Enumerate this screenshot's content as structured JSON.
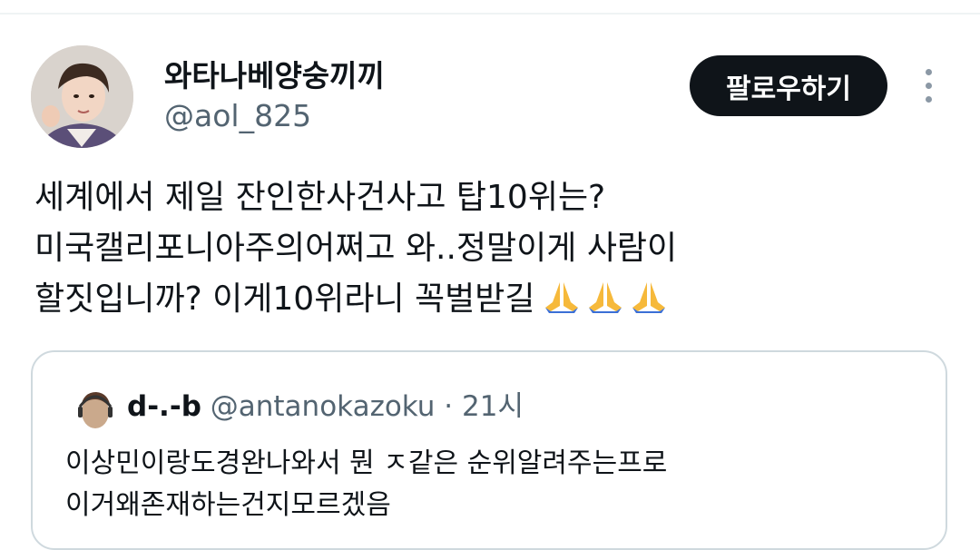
{
  "tweet": {
    "author": {
      "display_name": "와타나베양숭끼끼",
      "handle": "@aol_825"
    },
    "follow_label": "팔로우하기",
    "more_icon": "more-vertical-icon",
    "text_lines": [
      "세계에서 제일 잔인한사건사고 탑10위는?",
      "미국캘리포니아주의어쩌고 와..정말이게 사람이",
      "할짓입니까? 이게10위라니 꼭벌받길"
    ],
    "emoji": [
      "folded-hands-icon",
      "folded-hands-icon",
      "folded-hands-icon"
    ]
  },
  "quote": {
    "display_name": "d-.-b",
    "handle": "@antanokazoku",
    "separator": " · ",
    "time": "21시",
    "text_lines": [
      "이상민이랑도경완나와서 뭔 ㅈ같은 순위알려주는프로",
      "이거왜존재하는건지모르겠음"
    ]
  },
  "colors": {
    "text": "#0f1419",
    "secondary": "#536471",
    "border": "#cfd9de",
    "button_bg": "#0f1419",
    "button_text": "#ffffff"
  }
}
